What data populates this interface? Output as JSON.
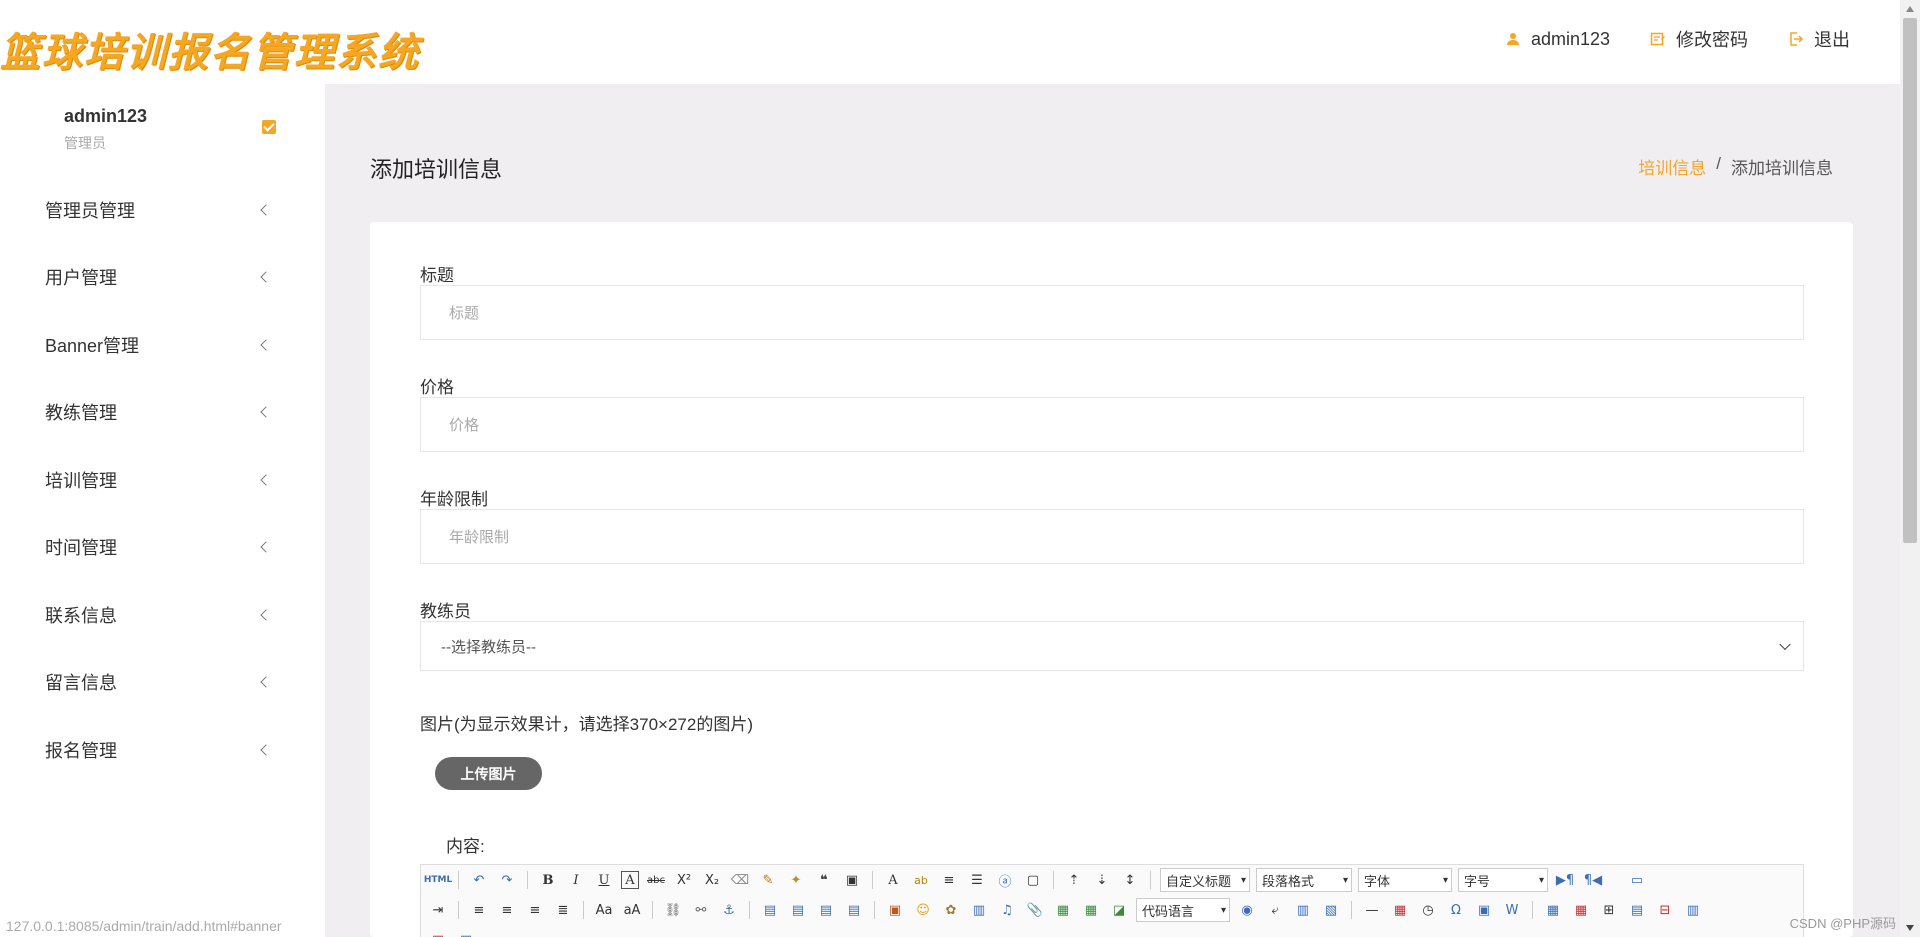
{
  "header": {
    "logo": "篮球培训报名管理系统",
    "nav": [
      {
        "label": "admin123",
        "icon": "user-icon"
      },
      {
        "label": "修改密码",
        "icon": "edit-icon"
      },
      {
        "label": "退出",
        "icon": "logout-icon"
      }
    ]
  },
  "sidebar": {
    "user": {
      "name": "admin123",
      "role": "管理员"
    },
    "items": [
      {
        "label": "管理员管理"
      },
      {
        "label": "用户管理"
      },
      {
        "label": "Banner管理"
      },
      {
        "label": "教练管理"
      },
      {
        "label": "培训管理"
      },
      {
        "label": "时间管理"
      },
      {
        "label": "联系信息"
      },
      {
        "label": "留言信息"
      },
      {
        "label": "报名管理"
      }
    ]
  },
  "page": {
    "title": "添加培训信息",
    "breadcrumb": {
      "link": "培训信息",
      "sep": "/",
      "current": "添加培训信息"
    }
  },
  "form": {
    "title": {
      "label": "标题",
      "placeholder": "标题"
    },
    "price": {
      "label": "价格",
      "placeholder": "价格"
    },
    "age": {
      "label": "年龄限制",
      "placeholder": "年龄限制"
    },
    "coach": {
      "label": "教练员",
      "selected": "--选择教练员--"
    },
    "image": {
      "label": "图片(为显示效果计，请选择370×272的图片)",
      "button": "上传图片"
    },
    "content": {
      "label": "内容:"
    }
  },
  "editor": {
    "selects": {
      "heading": "自定义标题",
      "paragraph": "段落格式",
      "font": "字体",
      "size": "字号",
      "code": "代码语言"
    }
  },
  "status": {
    "url": "127.0.0.1:8085/admin/train/add.html#banner",
    "watermark": "CSDN @PHP源码"
  },
  "colors": {
    "accent": "#f5a623",
    "main_bg": "#f1eef2"
  }
}
